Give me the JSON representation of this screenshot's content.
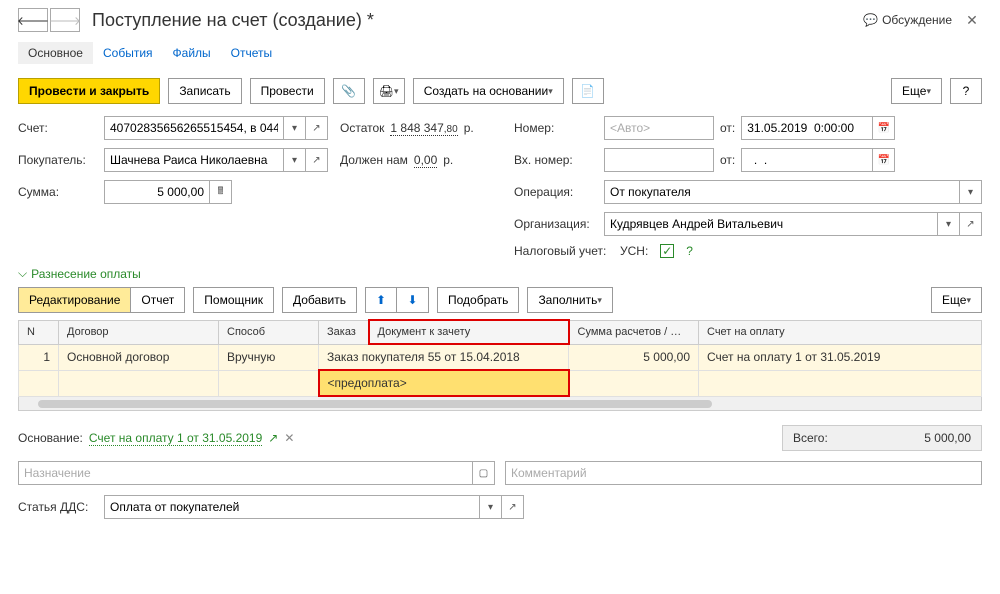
{
  "header": {
    "title": "Поступление на счет (создание) *",
    "discuss": "Обсуждение"
  },
  "tabs": [
    "Основное",
    "События",
    "Файлы",
    "Отчеты"
  ],
  "toolbar": {
    "post_close": "Провести и закрыть",
    "save": "Записать",
    "post": "Провести",
    "create_based": "Создать на основании",
    "more": "Еще",
    "help": "?"
  },
  "fields": {
    "account_label": "Счет:",
    "account_value": "40702835656265515454, в 044",
    "balance_label": "Остаток",
    "balance_value": "1 848 347",
    "balance_cents": ",80",
    "balance_cur": "р.",
    "number_label": "Номер:",
    "number_placeholder": "<Авто>",
    "from_label": "от:",
    "date_value": "31.05.2019  0:00:00",
    "buyer_label": "Покупатель:",
    "buyer_value": "Шачнева Раиса Николаевна",
    "owes_label": "Должен нам",
    "owes_value": "0,00",
    "owes_cur": "р.",
    "in_number_label": "Вх. номер:",
    "in_date_value": "  .  .",
    "sum_label": "Сумма:",
    "sum_value": "5 000,00",
    "operation_label": "Операция:",
    "operation_value": "От покупателя",
    "org_label": "Организация:",
    "org_value": "Кудрявцев Андрей Витальевич",
    "tax_label": "Налоговый учет:",
    "tax_value": "УСН:"
  },
  "section": {
    "title": "Разнесение оплаты",
    "edit": "Редактирование",
    "report": "Отчет",
    "helper": "Помощник",
    "add": "Добавить",
    "pick": "Подобрать",
    "fill": "Заполнить",
    "more": "Еще"
  },
  "table": {
    "headers": [
      "N",
      "Договор",
      "Способ",
      "Заказ",
      "Документ к зачету",
      "Сумма расчетов / …",
      "Счет на оплату"
    ],
    "row1": {
      "n": "1",
      "contract": "Основной договор",
      "method": "Вручную",
      "order_doc": "Заказ покупателя 55 от 15.04.2018",
      "sum": "5 000,00",
      "invoice": "Счет на оплату 1 от 31.05.2019"
    },
    "row2": {
      "prepay": "<предоплата>"
    }
  },
  "footer": {
    "basis_label": "Основание:",
    "basis_link": "Счет на оплату 1 от 31.05.2019",
    "total_label": "Всего:",
    "total_value": "5 000,00",
    "purpose_placeholder": "Назначение",
    "comment_placeholder": "Комментарий",
    "dds_label": "Статья ДДС:",
    "dds_value": "Оплата от покупателей"
  }
}
